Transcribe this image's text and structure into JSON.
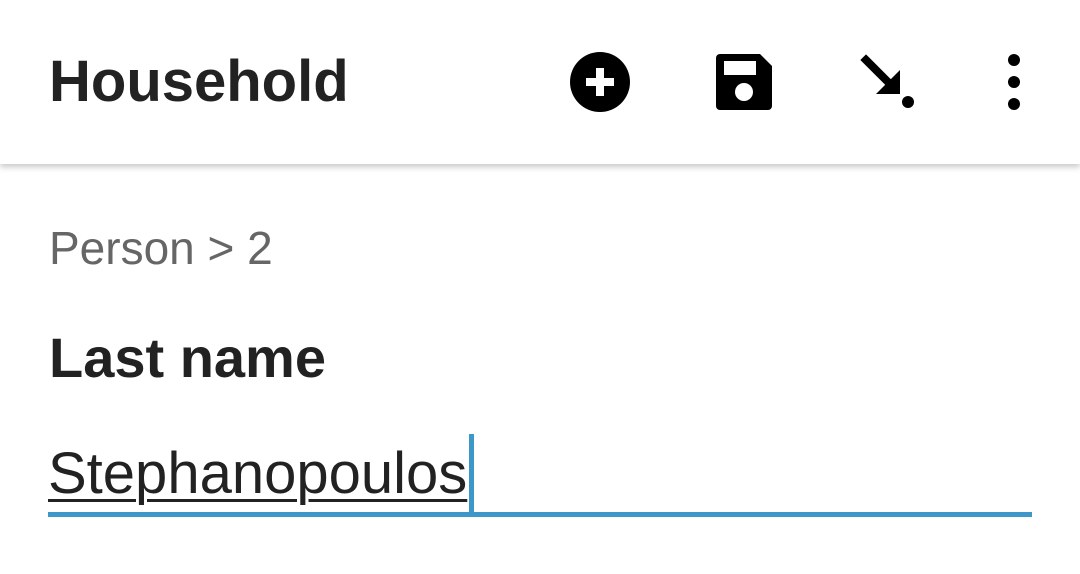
{
  "toolbar": {
    "title": "Household",
    "actions": [
      {
        "name": "add",
        "icon": "add-circle-icon"
      },
      {
        "name": "save",
        "icon": "save-icon"
      },
      {
        "name": "jump-to",
        "icon": "arrow-down-right-dot-icon"
      },
      {
        "name": "more",
        "icon": "more-vert-icon"
      }
    ]
  },
  "breadcrumb": "Person > 2",
  "field": {
    "label": "Last name",
    "value": "Stephanopoulos"
  },
  "colors": {
    "accent": "#3e97c9",
    "text_primary": "#222222",
    "text_secondary": "#666666",
    "icon": "#000000"
  }
}
